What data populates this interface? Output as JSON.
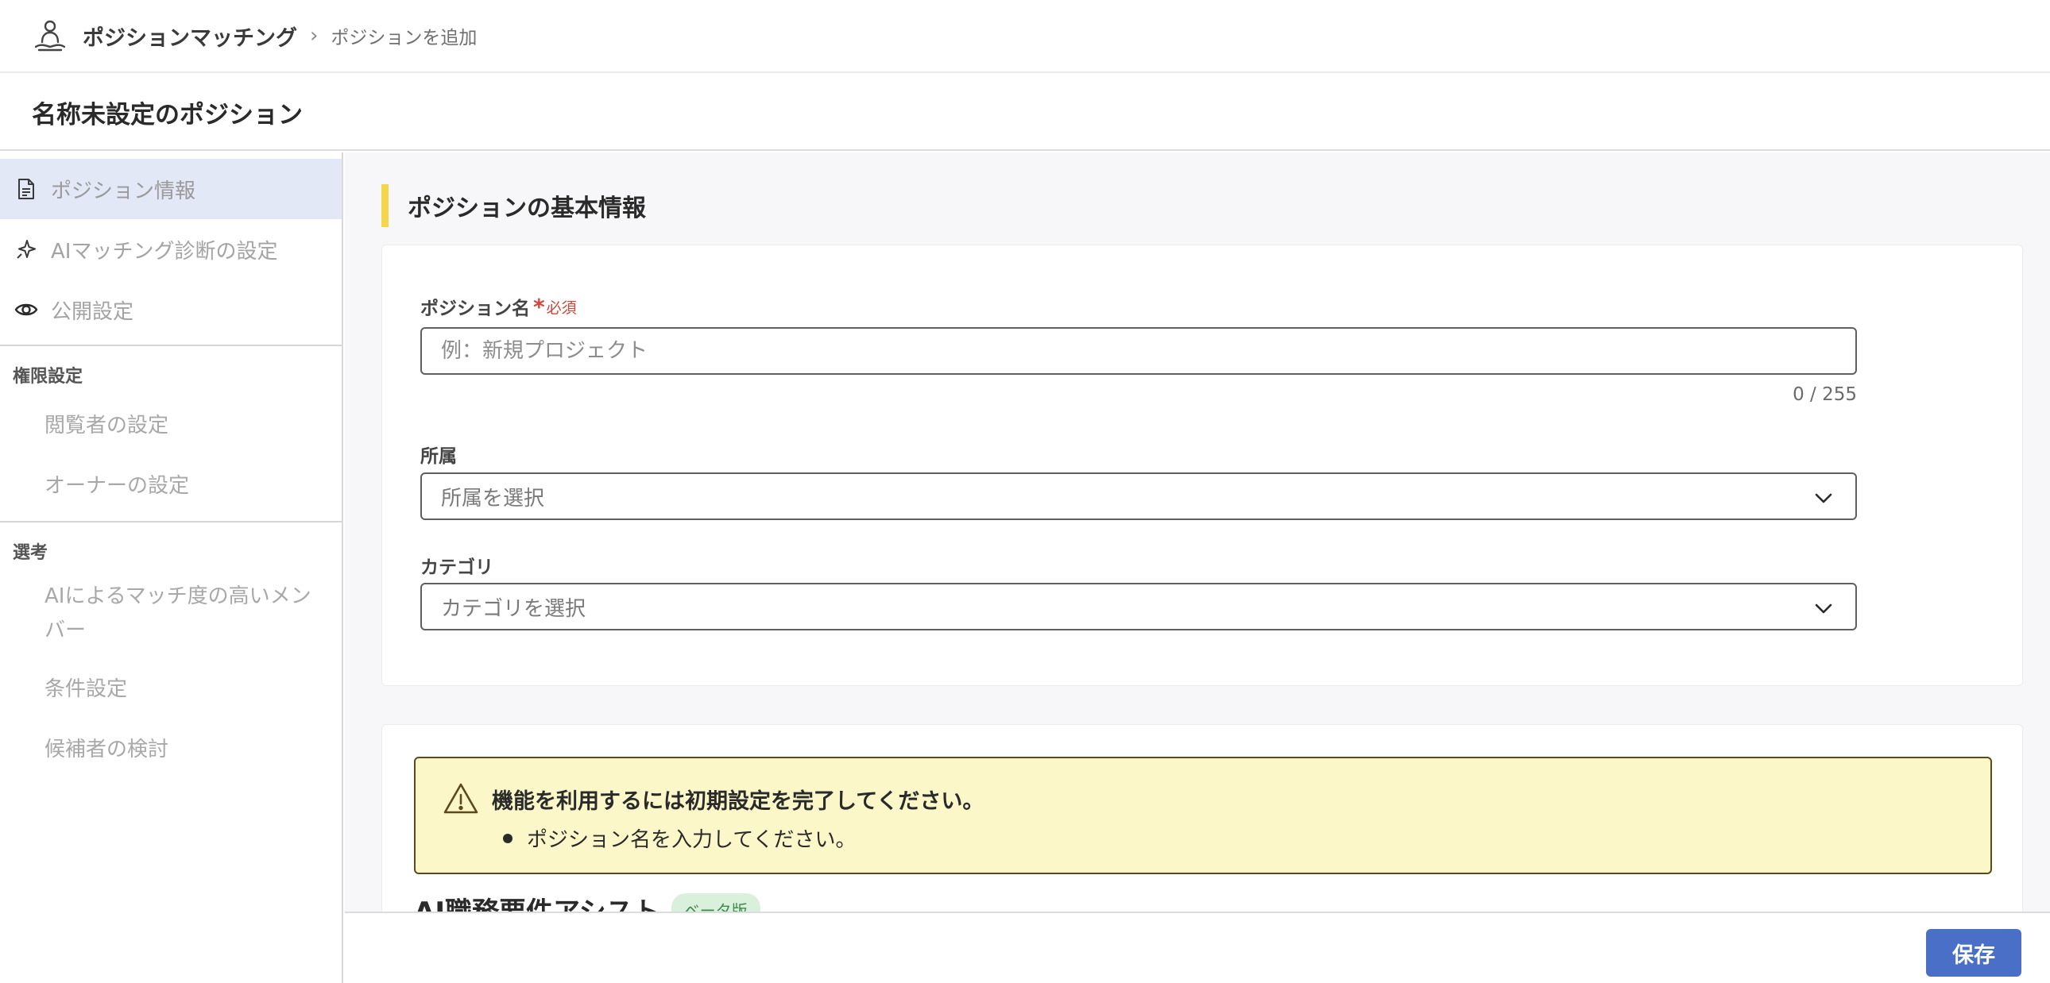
{
  "header": {
    "app_title": "ポジションマッチング",
    "breadcrumb_separator": "›",
    "breadcrumb_current": "ポジションを追加",
    "app_icon": "person-meditation-icon"
  },
  "page": {
    "title": "名称未設定のポジション"
  },
  "sidebar": {
    "items": [
      {
        "label": "ポジション情報",
        "icon": "document-icon",
        "active": true
      },
      {
        "label": "AIマッチング診断の設定",
        "icon": "sparkle-icon",
        "active": false
      },
      {
        "label": "公開設定",
        "icon": "eye-icon",
        "active": false
      }
    ],
    "sections": [
      {
        "heading": "権限設定",
        "items": [
          "閲覧者の設定",
          "オーナーの設定"
        ]
      },
      {
        "heading": "選考",
        "items": [
          "AIによるマッチ度の高いメンバー",
          "条件設定",
          "候補者の検討"
        ]
      }
    ]
  },
  "main": {
    "section_title": "ポジションの基本情報",
    "position_name": {
      "label": "ポジション名",
      "required_mark": "*",
      "required_text": "必須",
      "placeholder": "例：新規プロジェクト",
      "value": "",
      "counter": "0 / 255"
    },
    "affiliation": {
      "label": "所属",
      "placeholder": "所属を選択"
    },
    "category": {
      "label": "カテゴリ",
      "placeholder": "カテゴリを選択"
    },
    "warning": {
      "title": "機能を利用するには初期設定を完了してください。",
      "items": [
        "ポジション名を入力してください。"
      ]
    },
    "ai_assist": {
      "title": "AI職務要件アシスト",
      "badge": "ベータ版"
    }
  },
  "footer": {
    "save_label": "保存"
  },
  "colors": {
    "accent": "#4a6fc7",
    "section_bar": "#f4d64a",
    "active_nav_bg": "#e3e8f6",
    "warning_bg": "#fbf7c9",
    "required": "#d1453b",
    "beta_bg": "#d9f1dc"
  }
}
